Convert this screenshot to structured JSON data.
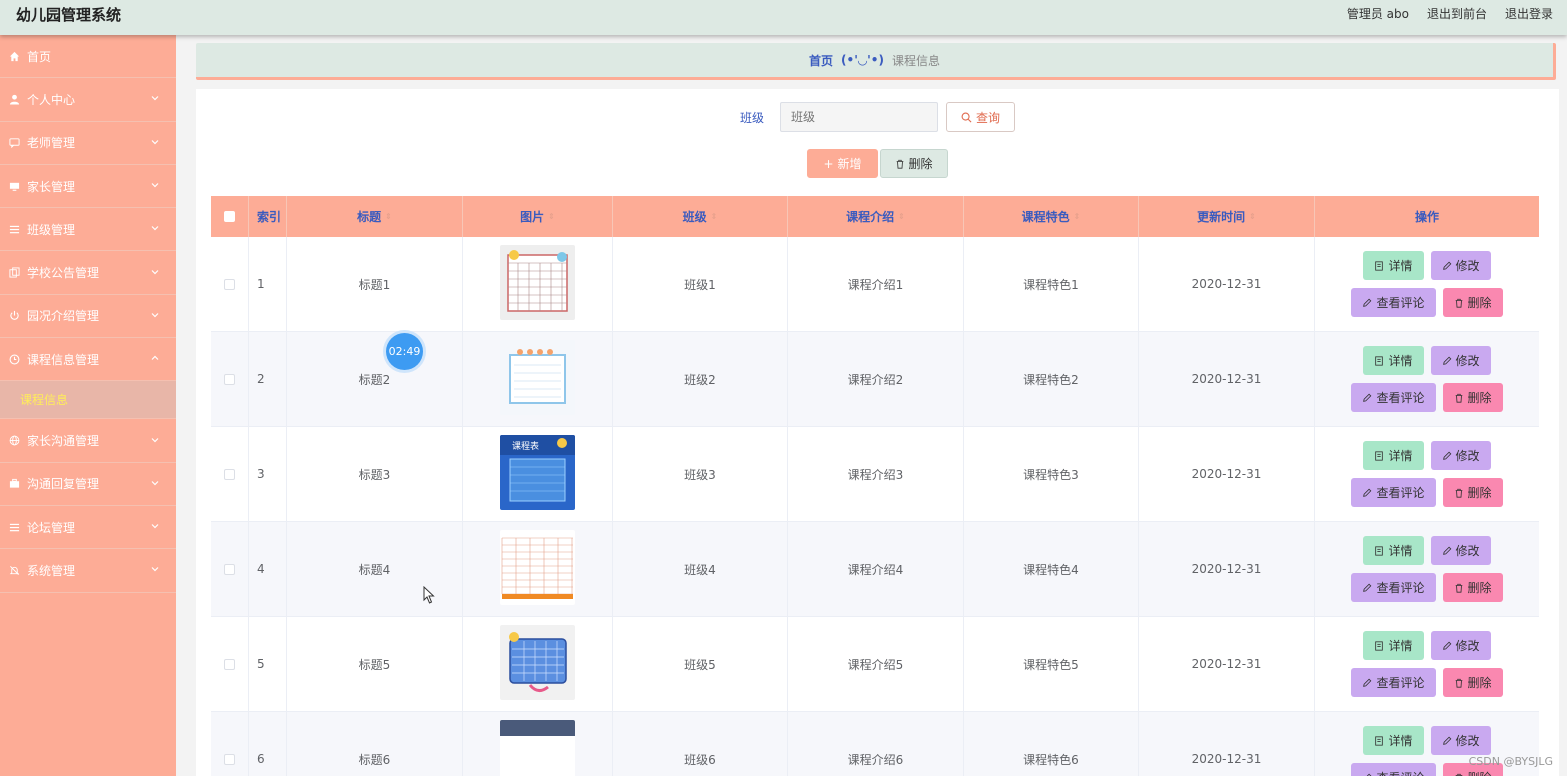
{
  "header": {
    "title": "幼儿园管理系统",
    "admin": "管理员 abo",
    "to_front": "退出到前台",
    "logout": "退出登录"
  },
  "sidebar": {
    "items": [
      {
        "label": "首页",
        "icon": "home-icon"
      },
      {
        "label": "个人中心",
        "icon": "user-icon"
      },
      {
        "label": "老师管理",
        "icon": "message-icon"
      },
      {
        "label": "家长管理",
        "icon": "monitor-icon"
      },
      {
        "label": "班级管理",
        "icon": "list-icon"
      },
      {
        "label": "学校公告管理",
        "icon": "copy-icon"
      },
      {
        "label": "园况介绍管理",
        "icon": "power-icon"
      },
      {
        "label": "课程信息管理",
        "icon": "clock-icon"
      },
      {
        "label": "家长沟通管理",
        "icon": "globe-icon"
      },
      {
        "label": "沟通回复管理",
        "icon": "briefcase-icon"
      },
      {
        "label": "论坛管理",
        "icon": "list-icon"
      },
      {
        "label": "系统管理",
        "icon": "bell-icon"
      }
    ],
    "sub_item": "课程信息"
  },
  "breadcrumb": {
    "home": "首页",
    "face": "(•'◡'•)",
    "current": "课程信息"
  },
  "search": {
    "label": "班级",
    "placeholder": "班级",
    "button": "查询"
  },
  "actions": {
    "add": "新增",
    "delete": "删除"
  },
  "table": {
    "headers": [
      "索引",
      "标题",
      "图片",
      "班级",
      "课程介绍",
      "课程特色",
      "更新时间",
      "操作"
    ],
    "rows": [
      {
        "idx": "1",
        "title": "标题1",
        "class": "班级1",
        "intro": "课程介绍1",
        "feature": "课程特色1",
        "time": "2020-12-31"
      },
      {
        "idx": "2",
        "title": "标题2",
        "class": "班级2",
        "intro": "课程介绍2",
        "feature": "课程特色2",
        "time": "2020-12-31"
      },
      {
        "idx": "3",
        "title": "标题3",
        "class": "班级3",
        "intro": "课程介绍3",
        "feature": "课程特色3",
        "time": "2020-12-31"
      },
      {
        "idx": "4",
        "title": "标题4",
        "class": "班级4",
        "intro": "课程介绍4",
        "feature": "课程特色4",
        "time": "2020-12-31"
      },
      {
        "idx": "5",
        "title": "标题5",
        "class": "班级5",
        "intro": "课程介绍5",
        "feature": "课程特色5",
        "time": "2020-12-31"
      },
      {
        "idx": "6",
        "title": "标题6",
        "class": "班级6",
        "intro": "课程介绍6",
        "feature": "课程特色6",
        "time": "2020-12-31"
      }
    ],
    "ops": {
      "detail": "详情",
      "edit": "修改",
      "comment": "查看评论",
      "delete": "删除"
    }
  },
  "overlay": {
    "timer": "02:49",
    "watermark": "CSDN @BYSJLG"
  },
  "colors": {
    "sidebar": "#fdac96",
    "header": "#dde9e3",
    "accent_text": "#3a5bbf",
    "detail_btn": "#a8e6c8",
    "edit_btn": "#c9a9f0",
    "delete_btn": "#fa88b0"
  }
}
